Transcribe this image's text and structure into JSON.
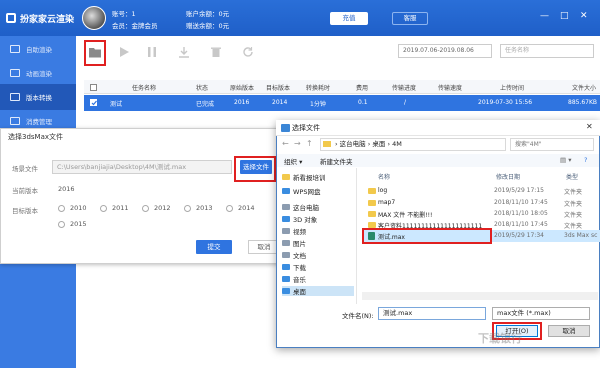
{
  "app": {
    "title": "扮家家云渲染",
    "account_label": "账号：",
    "account_value": "1",
    "member_label": "会员：",
    "member_value": "金牌会员",
    "balance_label": "账户余额：",
    "balance_value": "0元",
    "gift_label": "赠送余额：",
    "gift_value": "0元",
    "recharge": "充值",
    "service": "客服",
    "accent": "#2a6fd8"
  },
  "sidebar": {
    "items": [
      {
        "label": "自助渲染",
        "icon": "render-icon"
      },
      {
        "label": "动画渲染",
        "icon": "animation-icon"
      },
      {
        "label": "版本转换",
        "icon": "convert-icon"
      },
      {
        "label": "消费管理",
        "icon": "billing-icon"
      }
    ]
  },
  "toolbar": {
    "daterange": "2019.07.06-2019.08.06",
    "search_placeholder": "任务名称"
  },
  "table": {
    "headers": [
      "任务名称",
      "状态",
      "原始版本",
      "目标版本",
      "转换耗时",
      "费用",
      "传输进度",
      "传输速度",
      "上传时间",
      "文件大小"
    ],
    "row": [
      "测试",
      "已完成",
      "2016",
      "2014",
      "1分钟",
      "0.1",
      "/",
      "",
      "2019-07-30 15:56",
      "885.67KB"
    ]
  },
  "select_dialog": {
    "title": "选择3dsMax文件",
    "scene_label": "场景文件",
    "path": "C:\\Users\\banjiajia\\Desktop\\4M\\测试.max",
    "choose_button": "选择文件",
    "current_version_label": "当前版本",
    "current_version": "2016",
    "target_version_label": "目标版本",
    "versions": [
      "2010",
      "2011",
      "2012",
      "2013",
      "2014",
      "2015"
    ],
    "submit": "提交",
    "cancel": "取消"
  },
  "file_dialog": {
    "title": "选择文件",
    "breadcrumb": "› 这台电脑 › 桌面 › 4M",
    "search_placeholder": "搜索\"4M\"",
    "organize": "组织 ▾",
    "new_folder": "新建文件夹",
    "nav": [
      "新看报培训",
      "WPS网盘",
      "这台电脑",
      "3D 对象",
      "视频",
      "图片",
      "文档",
      "下载",
      "音乐",
      "桌面"
    ],
    "columns": [
      "名称",
      "修改日期",
      "类型"
    ],
    "files": [
      {
        "name": "log",
        "date": "2019/5/29 17:15",
        "type": "文件夹"
      },
      {
        "name": "map7",
        "date": "2018/11/10 17:45",
        "type": "文件夹"
      },
      {
        "name": "MAX 文件 不能删!!!",
        "date": "2018/11/10 18:05",
        "type": "文件夹"
      },
      {
        "name": "客户资料111111111111111111111",
        "date": "2018/11/10 17:45",
        "type": "文件夹"
      },
      {
        "name": "测试.max",
        "date": "2019/5/29 17:34",
        "type": "3ds Max sc"
      }
    ],
    "filename_label": "文件名(N):",
    "filename": "测试.max",
    "filter": "max文件 (*.max)",
    "open": "打开(O)",
    "cancel": "取消"
  },
  "watermark": "下载银行"
}
